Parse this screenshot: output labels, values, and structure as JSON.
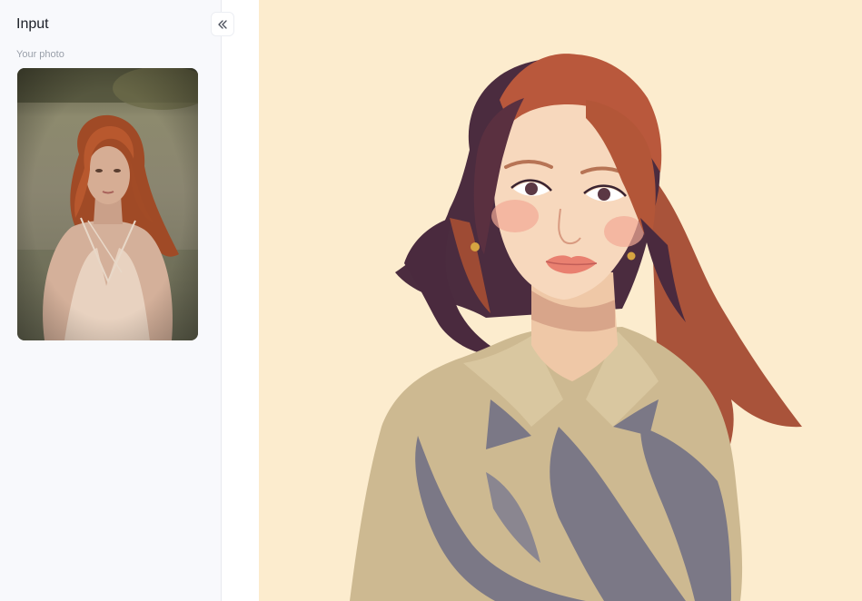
{
  "sidebar": {
    "title": "Input",
    "collapse_icon": "chevrons-left-icon",
    "section_label": "Your photo"
  },
  "colors": {
    "sidebar_bg": "#f8f9fc",
    "canvas_bg": "#fcecce",
    "hair_red": "#b8583a",
    "hair_dark": "#4a2b3d",
    "shirt": "#cdb990",
    "shirt_shadow": "#7b7886"
  }
}
